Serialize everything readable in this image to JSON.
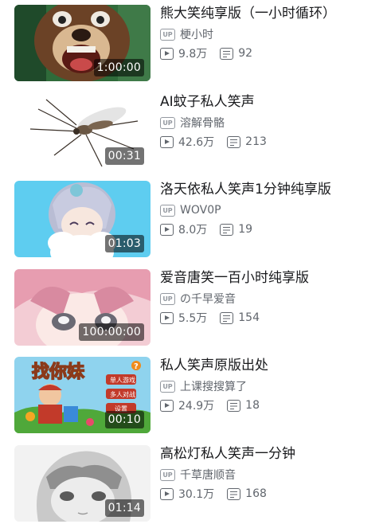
{
  "videos": [
    {
      "title": "熊大笑纯享版（一小时循环）",
      "duration": "1:00:00",
      "uploader": "梗小时",
      "views": "9.8万",
      "danmaku": "92",
      "thumb_icon": "bear-cartoon"
    },
    {
      "title": "AI蚊子私人笑声",
      "duration": "00:31",
      "uploader": "溶解骨骼",
      "views": "42.6万",
      "danmaku": "213",
      "thumb_icon": "mosquito"
    },
    {
      "title": "洛天依私人笑声1分钟纯享版",
      "duration": "01:03",
      "uploader": "WOV0P",
      "views": "8.0万",
      "danmaku": "19",
      "thumb_icon": "anime-girl-silver-hair"
    },
    {
      "title": "爱音唐笑一百小时纯享版",
      "duration": "100:00:00",
      "uploader": "の千早爱音",
      "views": "5.5万",
      "danmaku": "154",
      "thumb_icon": "anime-girl-pink-hair"
    },
    {
      "title": "私人笑声原版出处",
      "duration": "00:10",
      "uploader": "上课搜搜算了",
      "views": "24.9万",
      "danmaku": "18",
      "thumb_icon": "game-screen",
      "game_text": {
        "logo": "找你妹",
        "btn1": "单人游戏",
        "btn2": "多人对战",
        "btn3": "设置"
      }
    },
    {
      "title": "高松灯私人笑声一分钟",
      "duration": "01:14",
      "uploader": "千草唐顺音",
      "views": "30.1万",
      "danmaku": "168",
      "thumb_icon": "anime-girl-sketch"
    }
  ],
  "up_badge": "UP"
}
